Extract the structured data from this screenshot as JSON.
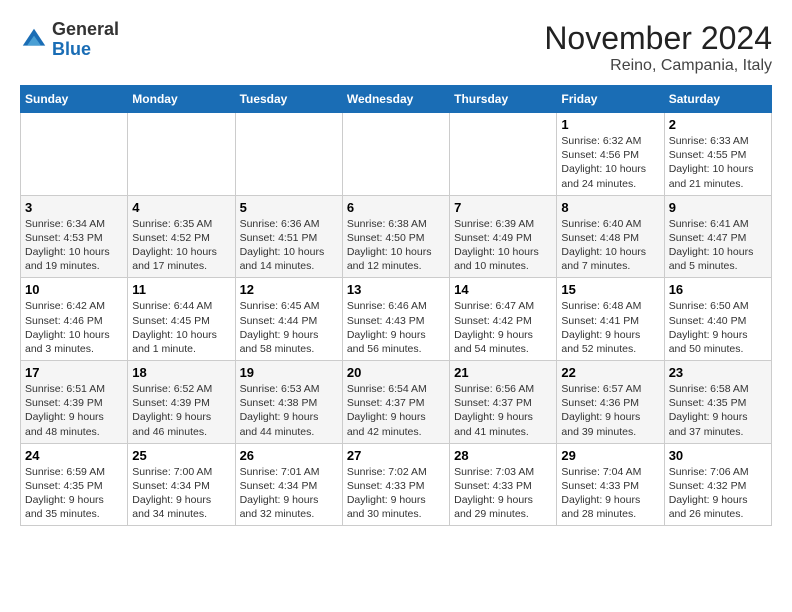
{
  "logo": {
    "general": "General",
    "blue": "Blue"
  },
  "title": "November 2024",
  "location": "Reino, Campania, Italy",
  "weekdays": [
    "Sunday",
    "Monday",
    "Tuesday",
    "Wednesday",
    "Thursday",
    "Friday",
    "Saturday"
  ],
  "weeks": [
    [
      {
        "day": "",
        "info": ""
      },
      {
        "day": "",
        "info": ""
      },
      {
        "day": "",
        "info": ""
      },
      {
        "day": "",
        "info": ""
      },
      {
        "day": "",
        "info": ""
      },
      {
        "day": "1",
        "info": "Sunrise: 6:32 AM\nSunset: 4:56 PM\nDaylight: 10 hours and 24 minutes."
      },
      {
        "day": "2",
        "info": "Sunrise: 6:33 AM\nSunset: 4:55 PM\nDaylight: 10 hours and 21 minutes."
      }
    ],
    [
      {
        "day": "3",
        "info": "Sunrise: 6:34 AM\nSunset: 4:53 PM\nDaylight: 10 hours and 19 minutes."
      },
      {
        "day": "4",
        "info": "Sunrise: 6:35 AM\nSunset: 4:52 PM\nDaylight: 10 hours and 17 minutes."
      },
      {
        "day": "5",
        "info": "Sunrise: 6:36 AM\nSunset: 4:51 PM\nDaylight: 10 hours and 14 minutes."
      },
      {
        "day": "6",
        "info": "Sunrise: 6:38 AM\nSunset: 4:50 PM\nDaylight: 10 hours and 12 minutes."
      },
      {
        "day": "7",
        "info": "Sunrise: 6:39 AM\nSunset: 4:49 PM\nDaylight: 10 hours and 10 minutes."
      },
      {
        "day": "8",
        "info": "Sunrise: 6:40 AM\nSunset: 4:48 PM\nDaylight: 10 hours and 7 minutes."
      },
      {
        "day": "9",
        "info": "Sunrise: 6:41 AM\nSunset: 4:47 PM\nDaylight: 10 hours and 5 minutes."
      }
    ],
    [
      {
        "day": "10",
        "info": "Sunrise: 6:42 AM\nSunset: 4:46 PM\nDaylight: 10 hours and 3 minutes."
      },
      {
        "day": "11",
        "info": "Sunrise: 6:44 AM\nSunset: 4:45 PM\nDaylight: 10 hours and 1 minute."
      },
      {
        "day": "12",
        "info": "Sunrise: 6:45 AM\nSunset: 4:44 PM\nDaylight: 9 hours and 58 minutes."
      },
      {
        "day": "13",
        "info": "Sunrise: 6:46 AM\nSunset: 4:43 PM\nDaylight: 9 hours and 56 minutes."
      },
      {
        "day": "14",
        "info": "Sunrise: 6:47 AM\nSunset: 4:42 PM\nDaylight: 9 hours and 54 minutes."
      },
      {
        "day": "15",
        "info": "Sunrise: 6:48 AM\nSunset: 4:41 PM\nDaylight: 9 hours and 52 minutes."
      },
      {
        "day": "16",
        "info": "Sunrise: 6:50 AM\nSunset: 4:40 PM\nDaylight: 9 hours and 50 minutes."
      }
    ],
    [
      {
        "day": "17",
        "info": "Sunrise: 6:51 AM\nSunset: 4:39 PM\nDaylight: 9 hours and 48 minutes."
      },
      {
        "day": "18",
        "info": "Sunrise: 6:52 AM\nSunset: 4:39 PM\nDaylight: 9 hours and 46 minutes."
      },
      {
        "day": "19",
        "info": "Sunrise: 6:53 AM\nSunset: 4:38 PM\nDaylight: 9 hours and 44 minutes."
      },
      {
        "day": "20",
        "info": "Sunrise: 6:54 AM\nSunset: 4:37 PM\nDaylight: 9 hours and 42 minutes."
      },
      {
        "day": "21",
        "info": "Sunrise: 6:56 AM\nSunset: 4:37 PM\nDaylight: 9 hours and 41 minutes."
      },
      {
        "day": "22",
        "info": "Sunrise: 6:57 AM\nSunset: 4:36 PM\nDaylight: 9 hours and 39 minutes."
      },
      {
        "day": "23",
        "info": "Sunrise: 6:58 AM\nSunset: 4:35 PM\nDaylight: 9 hours and 37 minutes."
      }
    ],
    [
      {
        "day": "24",
        "info": "Sunrise: 6:59 AM\nSunset: 4:35 PM\nDaylight: 9 hours and 35 minutes."
      },
      {
        "day": "25",
        "info": "Sunrise: 7:00 AM\nSunset: 4:34 PM\nDaylight: 9 hours and 34 minutes."
      },
      {
        "day": "26",
        "info": "Sunrise: 7:01 AM\nSunset: 4:34 PM\nDaylight: 9 hours and 32 minutes."
      },
      {
        "day": "27",
        "info": "Sunrise: 7:02 AM\nSunset: 4:33 PM\nDaylight: 9 hours and 30 minutes."
      },
      {
        "day": "28",
        "info": "Sunrise: 7:03 AM\nSunset: 4:33 PM\nDaylight: 9 hours and 29 minutes."
      },
      {
        "day": "29",
        "info": "Sunrise: 7:04 AM\nSunset: 4:33 PM\nDaylight: 9 hours and 28 minutes."
      },
      {
        "day": "30",
        "info": "Sunrise: 7:06 AM\nSunset: 4:32 PM\nDaylight: 9 hours and 26 minutes."
      }
    ]
  ]
}
